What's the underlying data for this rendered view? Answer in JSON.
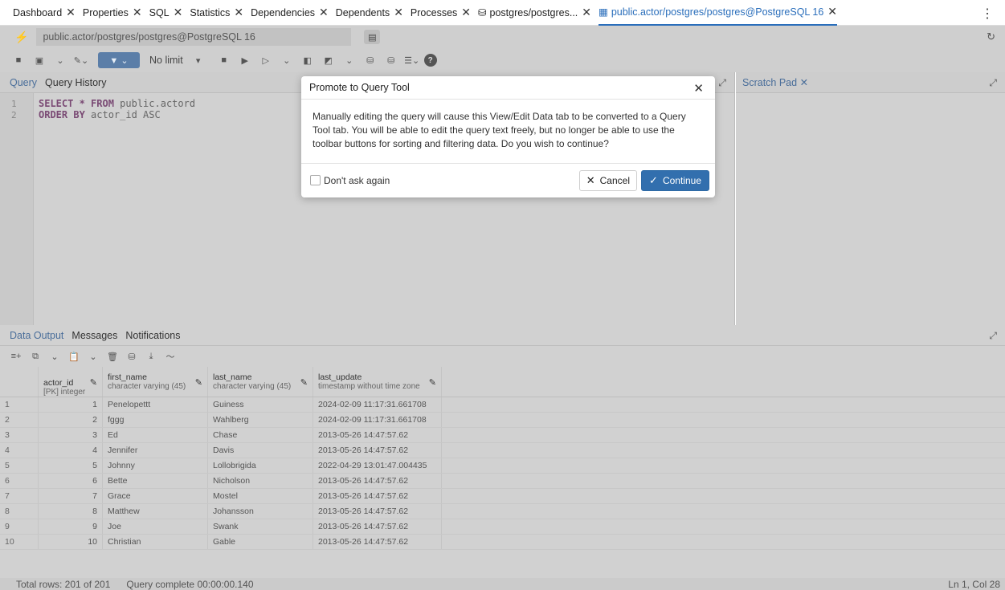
{
  "tabs": [
    {
      "label": "Dashboard",
      "icon": ""
    },
    {
      "label": "Properties",
      "icon": ""
    },
    {
      "label": "SQL",
      "icon": ""
    },
    {
      "label": "Statistics",
      "icon": ""
    },
    {
      "label": "Dependencies",
      "icon": ""
    },
    {
      "label": "Dependents",
      "icon": ""
    },
    {
      "label": "Processes",
      "icon": ""
    },
    {
      "label": "postgres/postgres...",
      "icon": "database-icon"
    },
    {
      "label": "public.actor/postgres/postgres@PostgreSQL 16",
      "icon": "table-icon",
      "active": true
    }
  ],
  "connection": {
    "label": "public.actor/postgres/postgres@PostgreSQL 16"
  },
  "toolbar": {
    "limit_label": "No limit"
  },
  "query_tabs": [
    "Query",
    "Query History"
  ],
  "scratch_tab": "Scratch Pad",
  "editor": {
    "lines": [
      {
        "num": "1",
        "keyword": "SELECT * FROM",
        "rest": " public.actord"
      },
      {
        "num": "2",
        "keyword": "ORDER BY",
        "rest": " actor_id ASC"
      }
    ]
  },
  "output_tabs": [
    "Data Output",
    "Messages",
    "Notifications"
  ],
  "columns": [
    {
      "name": "actor_id",
      "type": "[PK] integer"
    },
    {
      "name": "first_name",
      "type": "character varying (45)"
    },
    {
      "name": "last_name",
      "type": "character varying (45)"
    },
    {
      "name": "last_update",
      "type": "timestamp without time zone"
    }
  ],
  "rows": [
    [
      "1",
      "1",
      "Penelopettt",
      "Guiness",
      "2024-02-09 11:17:31.661708"
    ],
    [
      "2",
      "2",
      "fggg",
      "Wahlberg",
      "2024-02-09 11:17:31.661708"
    ],
    [
      "3",
      "3",
      "Ed",
      "Chase",
      "2013-05-26 14:47:57.62"
    ],
    [
      "4",
      "4",
      "Jennifer",
      "Davis",
      "2013-05-26 14:47:57.62"
    ],
    [
      "5",
      "5",
      "Johnny",
      "Lollobrigida",
      "2022-04-29 13:01:47.004435"
    ],
    [
      "6",
      "6",
      "Bette",
      "Nicholson",
      "2013-05-26 14:47:57.62"
    ],
    [
      "7",
      "7",
      "Grace",
      "Mostel",
      "2013-05-26 14:47:57.62"
    ],
    [
      "8",
      "8",
      "Matthew",
      "Johansson",
      "2013-05-26 14:47:57.62"
    ],
    [
      "9",
      "9",
      "Joe",
      "Swank",
      "2013-05-26 14:47:57.62"
    ],
    [
      "10",
      "10",
      "Christian",
      "Gable",
      "2013-05-26 14:47:57.62"
    ]
  ],
  "status": {
    "total_rows": "Total rows: 201 of 201",
    "query_complete": "Query complete 00:00:00.140",
    "cursor": "Ln 1, Col 28"
  },
  "dialog": {
    "title": "Promote to Query Tool",
    "message": "Manually editing the query will cause this View/Edit Data tab to be converted to a Query Tool tab. You will be able to edit the query text freely, but no longer be able to use the toolbar buttons for sorting and filtering data. Do you wish to continue?",
    "checkbox_label": "Don't ask again",
    "cancel_label": "Cancel",
    "continue_label": "Continue"
  },
  "colors": {
    "accent": "#326fae",
    "active_tab": "#2a6ebb"
  }
}
